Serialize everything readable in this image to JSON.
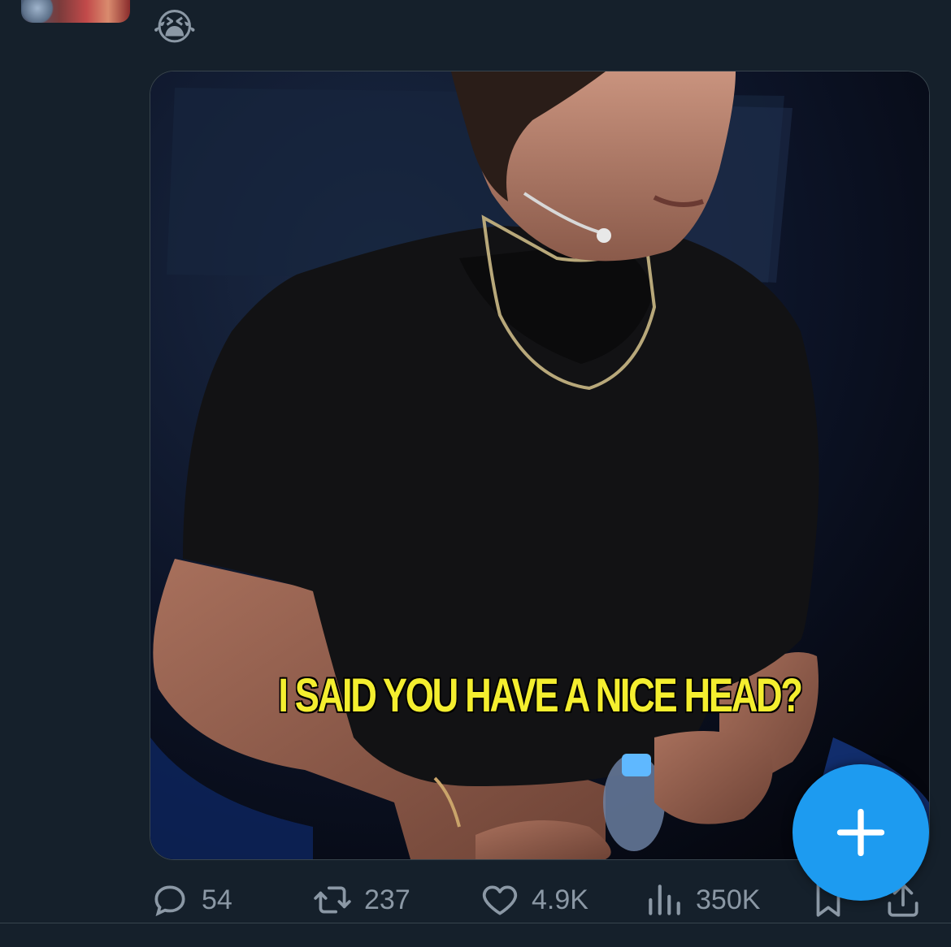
{
  "tweet": {
    "emoji": "😭",
    "media": {
      "caption": "I SAID YOU HAVE A NICE HEAD?"
    }
  },
  "actions": {
    "reply": {
      "icon": "reply-icon",
      "count": "54"
    },
    "retweet": {
      "icon": "retweet-icon",
      "count": "237"
    },
    "like": {
      "icon": "heart-icon",
      "count": "4.9K"
    },
    "views": {
      "icon": "views-chart-icon",
      "count": "350K"
    },
    "bookmark": {
      "icon": "bookmark-icon"
    },
    "share": {
      "icon": "share-icon"
    }
  },
  "fab": {
    "icon": "plus-icon"
  },
  "colors": {
    "background": "#15202b",
    "accent": "#1d9bf0",
    "muted": "#8b98a5",
    "caption": "#f4ee2f"
  }
}
